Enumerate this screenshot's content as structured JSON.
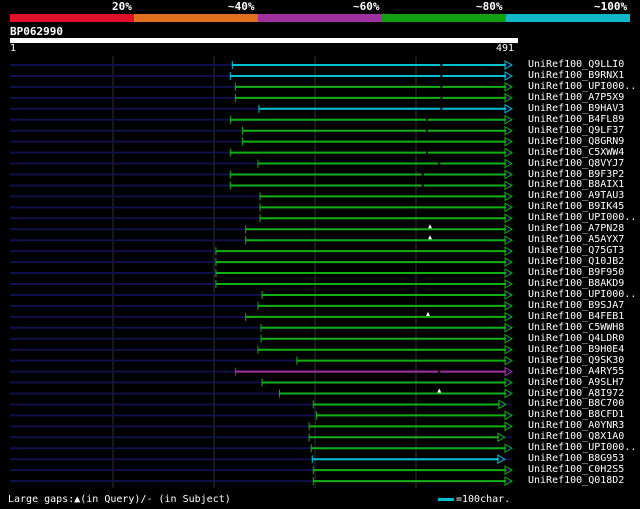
{
  "legend": {
    "labels": [
      "20%",
      "~40%",
      "~60%",
      "~80%",
      "~100%"
    ],
    "colors": [
      "#e0102a",
      "#e07020",
      "#a030a0",
      "#10a010",
      "#10b8c8"
    ]
  },
  "query": {
    "name": "BP062990",
    "start": "1",
    "end": "491",
    "length": 491
  },
  "colors": {
    "align_dark": "#10104a",
    "grid": "#303030",
    "green": "#10b010",
    "cyan": "#00c0d0",
    "purple": "#a030a0"
  },
  "hits": [
    {
      "name": "UniRef100_Q9LLI0",
      "start": 218,
      "end": 491,
      "color": "cyan",
      "gaps": [
        {
          "type": "subject",
          "pos": 422
        }
      ]
    },
    {
      "name": "UniRef100_B9RNX1",
      "start": 216,
      "end": 491,
      "color": "cyan",
      "gaps": [
        {
          "type": "subject",
          "pos": 422
        }
      ]
    },
    {
      "name": "UniRef100_UPI000..",
      "start": 221,
      "end": 491,
      "color": "green",
      "gaps": [
        {
          "type": "subject",
          "pos": 422
        }
      ]
    },
    {
      "name": "UniRef100_A7P5X9",
      "start": 221,
      "end": 491,
      "color": "green",
      "gaps": [
        {
          "type": "subject",
          "pos": 422
        }
      ]
    },
    {
      "name": "UniRef100_B9HAV3",
      "start": 244,
      "end": 491,
      "color": "cyan",
      "gaps": [
        {
          "type": "subject",
          "pos": 422
        }
      ]
    },
    {
      "name": "UniRef100_B4FL89",
      "start": 216,
      "end": 491,
      "color": "green",
      "gaps": [
        {
          "type": "subject",
          "pos": 408
        }
      ]
    },
    {
      "name": "UniRef100_Q9LF37",
      "start": 228,
      "end": 491,
      "color": "green",
      "gaps": [
        {
          "type": "subject",
          "pos": 408
        }
      ]
    },
    {
      "name": "UniRef100_Q8GRN9",
      "start": 228,
      "end": 491,
      "color": "green",
      "gaps": []
    },
    {
      "name": "UniRef100_C5XWW4",
      "start": 216,
      "end": 491,
      "color": "green",
      "gaps": [
        {
          "type": "subject",
          "pos": 408
        }
      ]
    },
    {
      "name": "UniRef100_Q8VYJ7",
      "start": 243,
      "end": 491,
      "color": "green",
      "gaps": [
        {
          "type": "subject",
          "pos": 420
        }
      ]
    },
    {
      "name": "UniRef100_B9F3P2",
      "start": 216,
      "end": 491,
      "color": "green",
      "gaps": [
        {
          "type": "subject",
          "pos": 404
        }
      ]
    },
    {
      "name": "UniRef100_B8AIX1",
      "start": 216,
      "end": 491,
      "color": "green",
      "gaps": [
        {
          "type": "subject",
          "pos": 404
        }
      ]
    },
    {
      "name": "UniRef100_A9TAU3",
      "start": 245,
      "end": 491,
      "color": "green",
      "gaps": []
    },
    {
      "name": "UniRef100_B9IK45",
      "start": 245,
      "end": 491,
      "color": "green",
      "gaps": []
    },
    {
      "name": "UniRef100_UPI000..",
      "start": 245,
      "end": 491,
      "color": "green",
      "gaps": []
    },
    {
      "name": "UniRef100_A7PN28",
      "start": 231,
      "end": 491,
      "color": "green",
      "gaps": [
        {
          "type": "query",
          "pos": 411
        }
      ]
    },
    {
      "name": "UniRef100_A5AYX7",
      "start": 231,
      "end": 491,
      "color": "green",
      "gaps": [
        {
          "type": "query",
          "pos": 411
        }
      ]
    },
    {
      "name": "UniRef100_Q75GT3",
      "start": 202,
      "end": 491,
      "color": "green",
      "gaps": []
    },
    {
      "name": "UniRef100_Q10JB2",
      "start": 202,
      "end": 491,
      "color": "green",
      "gaps": []
    },
    {
      "name": "UniRef100_B9F950",
      "start": 202,
      "end": 491,
      "color": "green",
      "gaps": []
    },
    {
      "name": "UniRef100_B8AKD9",
      "start": 202,
      "end": 491,
      "color": "green",
      "gaps": []
    },
    {
      "name": "UniRef100_UPI000..",
      "start": 247,
      "end": 491,
      "color": "green",
      "gaps": []
    },
    {
      "name": "UniRef100_B9SJA7",
      "start": 243,
      "end": 491,
      "color": "green",
      "gaps": []
    },
    {
      "name": "UniRef100_B4FEB1",
      "start": 231,
      "end": 491,
      "color": "green",
      "gaps": [
        {
          "type": "query",
          "pos": 409
        }
      ]
    },
    {
      "name": "UniRef100_C5WWH8",
      "start": 246,
      "end": 491,
      "color": "green",
      "gaps": []
    },
    {
      "name": "UniRef100_Q4LDR0",
      "start": 246,
      "end": 491,
      "color": "green",
      "gaps": []
    },
    {
      "name": "UniRef100_B9H0E4",
      "start": 243,
      "end": 491,
      "color": "green",
      "gaps": []
    },
    {
      "name": "UniRef100_Q9SK30",
      "start": 281,
      "end": 491,
      "color": "green",
      "gaps": []
    },
    {
      "name": "UniRef100_A4RY55",
      "start": 221,
      "end": 491,
      "color": "purple",
      "gaps": [
        {
          "type": "subject",
          "pos": 420
        }
      ]
    },
    {
      "name": "UniRef100_A9SLH7",
      "start": 247,
      "end": 491,
      "color": "green",
      "gaps": []
    },
    {
      "name": "UniRef100_A8I972",
      "start": 264,
      "end": 491,
      "color": "green",
      "gaps": [
        {
          "type": "query",
          "pos": 420
        }
      ]
    },
    {
      "name": "UniRef100_B8C700",
      "start": 297,
      "end": 485,
      "color": "green",
      "gaps": []
    },
    {
      "name": "UniRef100_B8CFD1",
      "start": 300,
      "end": 491,
      "color": "green",
      "gaps": []
    },
    {
      "name": "UniRef100_A0YNR3",
      "start": 293,
      "end": 491,
      "color": "green",
      "gaps": []
    },
    {
      "name": "UniRef100_Q8X1A0",
      "start": 293,
      "end": 484,
      "color": "green",
      "gaps": []
    },
    {
      "name": "UniRef100_UPI000..",
      "start": 295,
      "end": 491,
      "color": "green",
      "gaps": []
    },
    {
      "name": "UniRef100_B8G953",
      "start": 296,
      "end": 484,
      "color": "cyan",
      "gaps": []
    },
    {
      "name": "UniRef100_C0H2S5",
      "start": 297,
      "end": 491,
      "color": "green",
      "gaps": []
    },
    {
      "name": "UniRef100_Q018D2",
      "start": 297,
      "end": 491,
      "color": "green",
      "gaps": []
    }
  ],
  "footer": {
    "gap_legend": "Large gaps:▲(in Query)/- (in Subject)",
    "scale_label": "=100char."
  }
}
